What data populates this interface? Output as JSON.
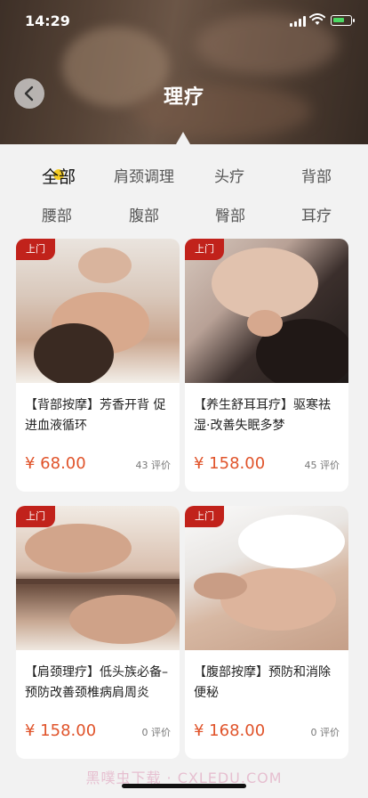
{
  "status_bar": {
    "time": "14:29"
  },
  "header": {
    "title": "理疗"
  },
  "categories": [
    {
      "label": "全部",
      "active": true
    },
    {
      "label": "肩颈调理",
      "active": false
    },
    {
      "label": "头疗",
      "active": false
    },
    {
      "label": "背部",
      "active": false
    },
    {
      "label": "腰部",
      "active": false
    },
    {
      "label": "腹部",
      "active": false
    },
    {
      "label": "臀部",
      "active": false
    },
    {
      "label": "耳疗",
      "active": false
    }
  ],
  "products": [
    {
      "badge": "上门",
      "title": "【背部按摩】芳香开背 促进血液循环",
      "price": "¥ 68.00",
      "reviews": "43 评价"
    },
    {
      "badge": "上门",
      "title": "【养生舒耳耳疗】驱寒祛湿·改善失眠多梦",
      "price": "¥ 158.00",
      "reviews": "45 评价"
    },
    {
      "badge": "上门",
      "title": "【肩颈理疗】低头族必备–预防改善颈椎病肩周炎",
      "price": "¥ 158.00",
      "reviews": "0 评价"
    },
    {
      "badge": "上门",
      "title": "【腹部按摩】预防和消除便秘",
      "price": "¥ 168.00",
      "reviews": "0 评价"
    }
  ],
  "watermark": "黑噗虫下载 · CXLEDU.COM",
  "icons": {
    "back": "chevron-left-icon",
    "signal": "cellular-signal-icon",
    "wifi": "wifi-icon",
    "battery": "battery-charging-icon"
  },
  "colors": {
    "price": "#e0532a",
    "badge": "#c1221b",
    "active_mark": "#f4c400"
  }
}
